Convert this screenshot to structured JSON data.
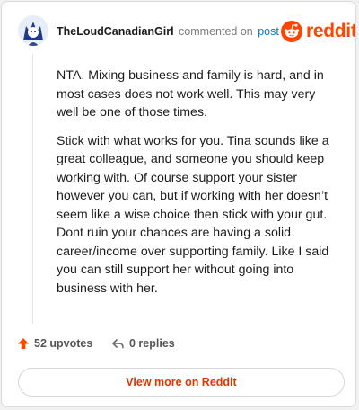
{
  "header": {
    "author": "TheLoudCanadianGirl",
    "action": "commented on",
    "post_link": "post",
    "brand": "reddit",
    "brand_color": "#ff4500"
  },
  "comment": {
    "paragraphs": [
      "NTA. Mixing business and family is hard, and in most cases does not work well. This may very well be one of those times.",
      "Stick with what works for you. Tina sounds like a great colleague, and someone you should keep working with. Of course support your sister however you can, but if working with her doesn’t seem like a wise choice then stick with your gut. Dont ruin your chances are having a solid career/income over supporting family. Like I said you can still support her without going into business with her."
    ]
  },
  "footer": {
    "upvotes": "52 upvotes",
    "replies": "0 replies",
    "upvote_icon": "upvote-arrow-icon",
    "reply_icon": "reply-arrow-icon"
  },
  "cta": {
    "label": "View more on Reddit"
  }
}
